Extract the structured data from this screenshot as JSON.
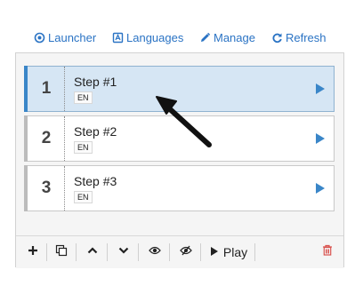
{
  "topbar": {
    "launcher": "Launcher",
    "languages": "Languages",
    "manage": "Manage",
    "refresh": "Refresh"
  },
  "steps": [
    {
      "number": "1",
      "title": "Step #1",
      "lang": "EN",
      "selected": true
    },
    {
      "number": "2",
      "title": "Step #2",
      "lang": "EN",
      "selected": false
    },
    {
      "number": "3",
      "title": "Step #3",
      "lang": "EN",
      "selected": false
    }
  ],
  "toolbar": {
    "play_label": "Play"
  },
  "colors": {
    "link": "#2a73c4",
    "accent": "#3a86c8",
    "selected_row": "#d6e6f4",
    "delete": "#d9534f"
  },
  "icons": [
    "circle-dot-icon",
    "flag-icon",
    "pencil-icon",
    "refresh-icon",
    "plus-icon",
    "copy-icon",
    "chevron-up-icon",
    "chevron-down-icon",
    "eye-icon",
    "eye-slash-icon",
    "play-icon",
    "trash-icon",
    "arrow-pointer"
  ]
}
